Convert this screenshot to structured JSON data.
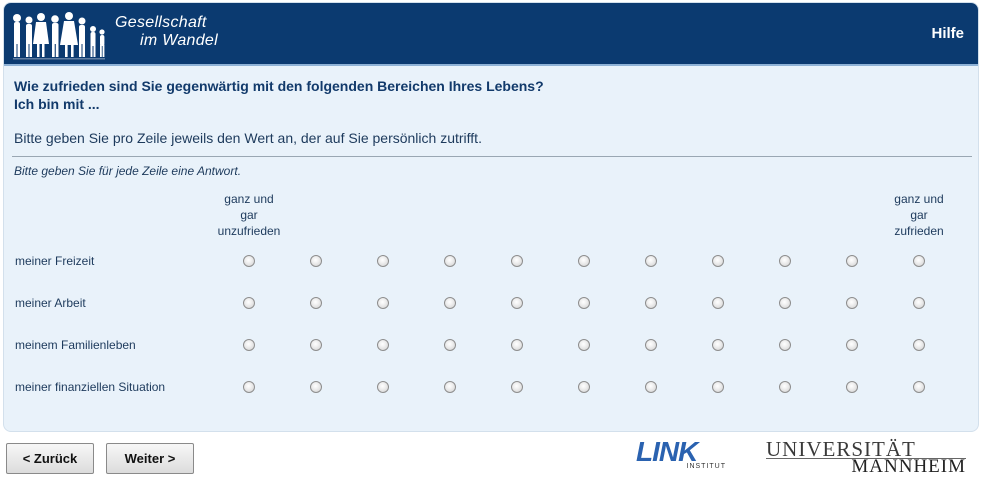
{
  "header": {
    "logo_line1": "Gesellschaft",
    "logo_line2": "im Wandel",
    "help_label": "Hilfe"
  },
  "question": {
    "line1": "Wie zufrieden sind Sie gegenwärtig mit den folgenden Bereichen Ihres Lebens?",
    "line2": "Ich bin mit ...",
    "instruction": "Bitte geben Sie pro Zeile jeweils den Wert an, der auf Sie persönlich zutrifft.",
    "hint": "Bitte geben Sie für jede Zeile eine Antwort."
  },
  "scale": {
    "low_label": [
      "ganz und",
      "gar",
      "unzufrieden"
    ],
    "high_label": [
      "ganz und",
      "gar",
      "zufrieden"
    ],
    "points": 11
  },
  "rows": [
    {
      "label": "meiner Freizeit",
      "selected": null
    },
    {
      "label": "meiner Arbeit",
      "selected": null
    },
    {
      "label": "meinem Familienleben",
      "selected": null
    },
    {
      "label": "meiner finanziellen Situation",
      "selected": null
    }
  ],
  "nav": {
    "back_label": "< Zurück",
    "next_label": "Weiter >"
  },
  "logos": {
    "link_word": "LINK",
    "link_sub": "INSTITUT",
    "uni_line1": "UNIVERSITÄT",
    "uni_line2": "MANNHEIM"
  },
  "colors": {
    "header_bg": "#0b3a70",
    "panel_bg": "#e9f2fa",
    "question_text": "#123a6b",
    "link_blue": "#2a62b0"
  }
}
